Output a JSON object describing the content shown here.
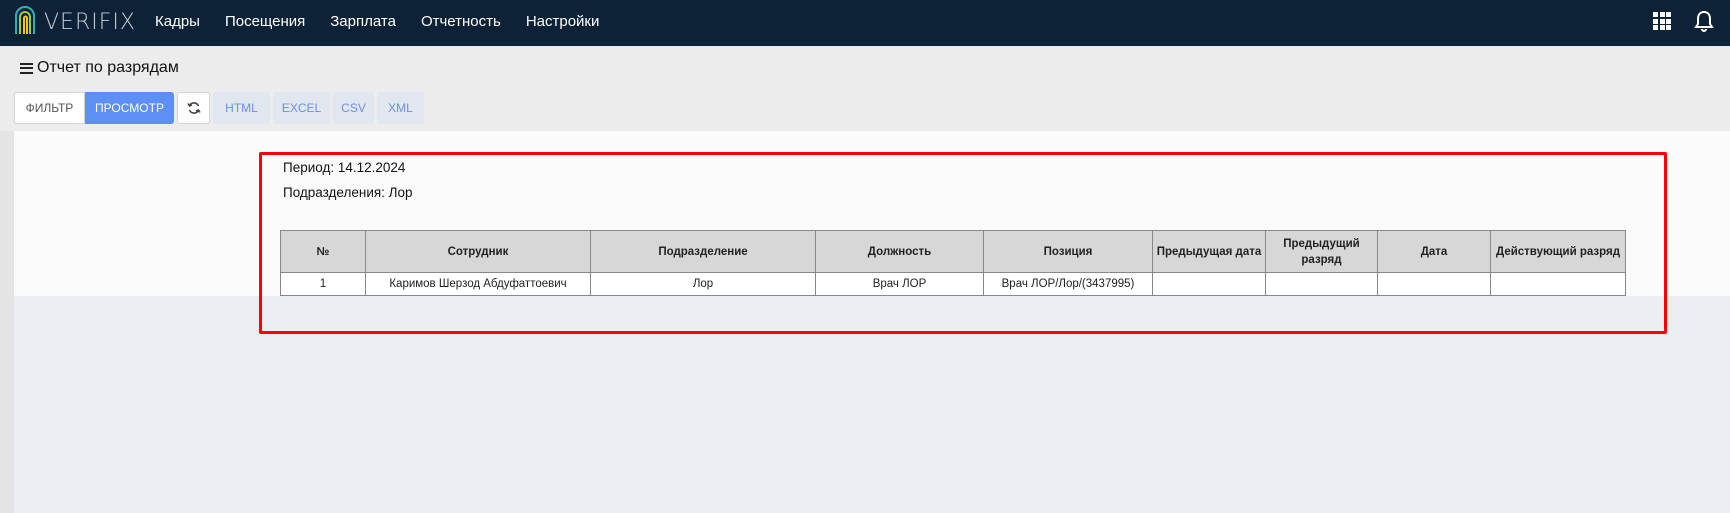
{
  "app": {
    "logo_text": "VERIFIX",
    "nav": [
      "Кадры",
      "Посещения",
      "Зарплата",
      "Отчетность",
      "Настройки"
    ],
    "icons": [
      "apps-grid-icon",
      "bell-icon"
    ]
  },
  "page": {
    "title": "Отчет по разрядам",
    "toolbar": {
      "filter": "ФИЛЬТР",
      "view": "ПРОСМОТР",
      "refresh_icon": "refresh-icon",
      "exports": [
        "HTML",
        "EXCEL",
        "CSV",
        "XML"
      ]
    }
  },
  "report": {
    "period": "Период: 14.12.2024",
    "departments": "Подразделения: Лор",
    "columns": [
      "№",
      "Сотрудник",
      "Подразделение",
      "Должность",
      "Позиция",
      "Предыдущая дата",
      "Предыдущий разряд",
      "Дата",
      "Действующий разряд"
    ],
    "rows": [
      [
        "1",
        "Каримов Шерзод Абдуфаттоевич",
        "Лор",
        "Врач ЛОР",
        "Врач ЛОР/Лор/(3437995)",
        "",
        "",
        "",
        ""
      ]
    ]
  },
  "colors": {
    "topbar": "#0d2237",
    "accent": "#5d8ff4",
    "highlight": "#ff0000"
  }
}
